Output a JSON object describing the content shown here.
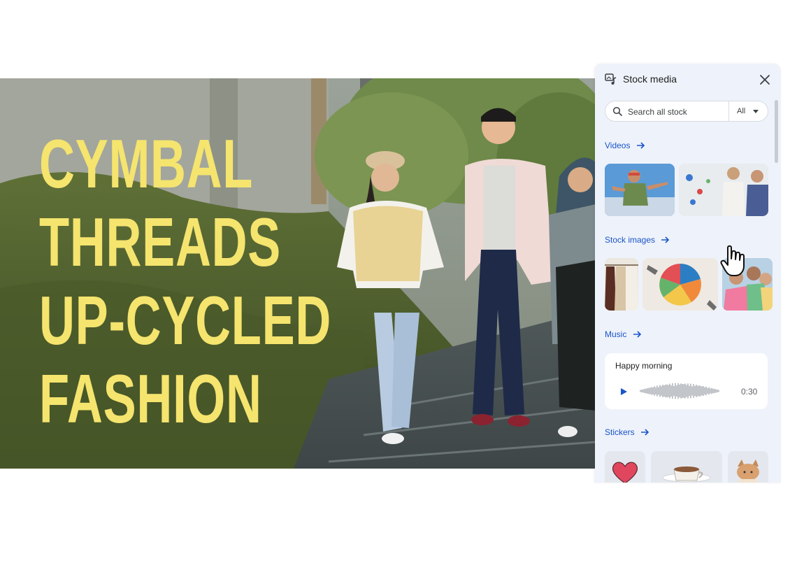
{
  "hero": {
    "title_lines": [
      "CYMBAL",
      "THREADS",
      "UP-CYCLED",
      "FASHION"
    ],
    "title_color": "#f5e46e"
  },
  "panel": {
    "title": "Stock media",
    "icon": "stock-media-icon",
    "close_icon": "close-icon",
    "search": {
      "placeholder": "Search all stock",
      "filter_label": "All"
    },
    "sections": {
      "videos": "Videos",
      "images": "Stock images",
      "music": "Music",
      "stickers": "Stickers"
    },
    "music_track": {
      "title": "Happy morning",
      "duration": "0:30"
    },
    "accent_color": "#1a55c9",
    "background_color": "#eef2fa"
  }
}
